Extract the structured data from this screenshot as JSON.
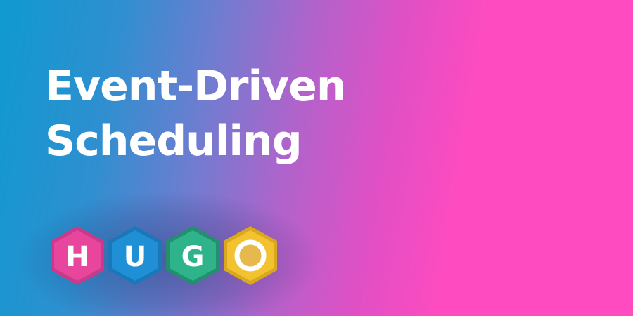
{
  "title": {
    "line1": "Event-Driven",
    "line2": "Scheduling"
  },
  "logo": {
    "name": "hugo-logo-icon",
    "letters": [
      "H",
      "U",
      "G",
      "O"
    ],
    "colors": {
      "h": "#e8469c",
      "u": "#1f8fd6",
      "g": "#2fb38a",
      "o": "#f2c230",
      "o_ring": "#e6b84e"
    }
  },
  "colors": {
    "gradient_left": "#0f9ad0",
    "gradient_right": "#ff4bc0",
    "text": "#ffffff"
  }
}
